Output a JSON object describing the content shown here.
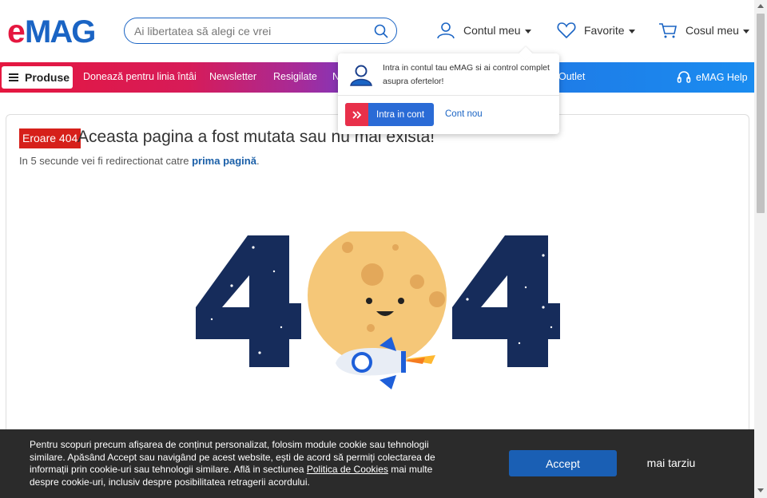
{
  "header": {
    "logo_text": "eMAG",
    "search_placeholder": "Ai libertatea să alegi ce vrei",
    "account_label": "Contul meu",
    "favorites_label": "Favorite",
    "cart_label": "Cosul meu"
  },
  "navbar": {
    "products_label": "Produse",
    "links": [
      "Donează pentru linia întâi",
      "Newsletter",
      "Resigilate",
      "N",
      "Outlet"
    ],
    "help_label": "eMAG Help"
  },
  "account_dropdown": {
    "message": "Intra in contul tau eMAG si ai control complet asupra ofertelor!",
    "login_button": "Intra in cont",
    "new_account_link": "Cont nou"
  },
  "error": {
    "badge": "Eroare 404",
    "title": "Aceasta pagina a fost mutata sau nu mai exista!",
    "redirect_prefix": "In 5 secunde vei fi redirectionat catre ",
    "redirect_link": "prima pagină",
    "redirect_suffix": "."
  },
  "cookie_banner": {
    "text_before_link": "Pentru scopuri precum afișarea de conținut personalizat, folosim module cookie sau tehnologii similare. Apăsând Accept sau navigând pe acest website, ești de acord să permiți colectarea de informații prin cookie-uri sau tehnologii similare. Află in sectiunea ",
    "policy_link": "Politica de Cookies",
    "text_after_link": " mai multe despre cookie-uri, inclusiv despre posibilitatea retragerii acordului.",
    "accept_button": "Accept",
    "later_button": "mai tarziu"
  },
  "colors": {
    "brand_red": "#e5173f",
    "brand_blue": "#1a64c4",
    "error_red": "#d6201a",
    "cookie_bg": "#2b2b2b"
  },
  "icons": [
    "search-icon",
    "user-icon",
    "heart-icon",
    "cart-icon",
    "menu-icon",
    "headset-icon",
    "chevron-right-icon"
  ]
}
